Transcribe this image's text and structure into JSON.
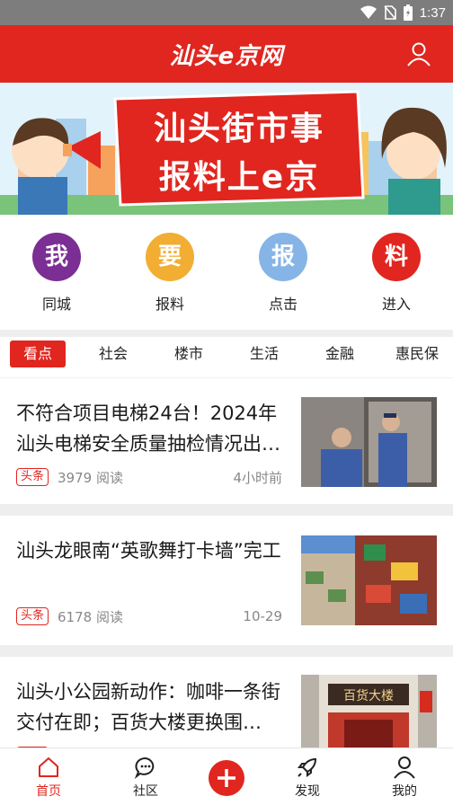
{
  "status_bar": {
    "time": "1:37"
  },
  "header": {
    "logo_text": "汕头e京网"
  },
  "banner": {
    "line1": "汕头街市事",
    "line2": "报料上e京"
  },
  "quick_actions": [
    {
      "char": "我",
      "label": "同城",
      "color": "#7b2e94"
    },
    {
      "char": "要",
      "label": "报料",
      "color": "#f2ad33"
    },
    {
      "char": "报",
      "label": "点击",
      "color": "#86b4e6"
    },
    {
      "char": "料",
      "label": "进入",
      "color": "#e0261f"
    }
  ],
  "tabs": [
    "看点",
    "社会",
    "楼市",
    "生活",
    "金融",
    "惠民保"
  ],
  "news": [
    {
      "title": "不符合项目电梯24台！2024年汕头电梯安全质量抽检情况出…",
      "tag": "头条",
      "reads": "3979 阅读",
      "time": "4小时前"
    },
    {
      "title": "汕头龙眼南“英歌舞打卡墙”完工",
      "tag": "头条",
      "reads": "6178 阅读",
      "time": "10-29"
    },
    {
      "title": "汕头小公园新动作：咖啡一条街交付在即；百货大楼更换围…",
      "tag": "头条",
      "reads": "",
      "time": ""
    }
  ],
  "thumb3_sign": "百货大楼",
  "bottom_nav": [
    "首页",
    "社区",
    "",
    "发现",
    "我的"
  ],
  "colors": {
    "brand_red": "#e0261f"
  }
}
